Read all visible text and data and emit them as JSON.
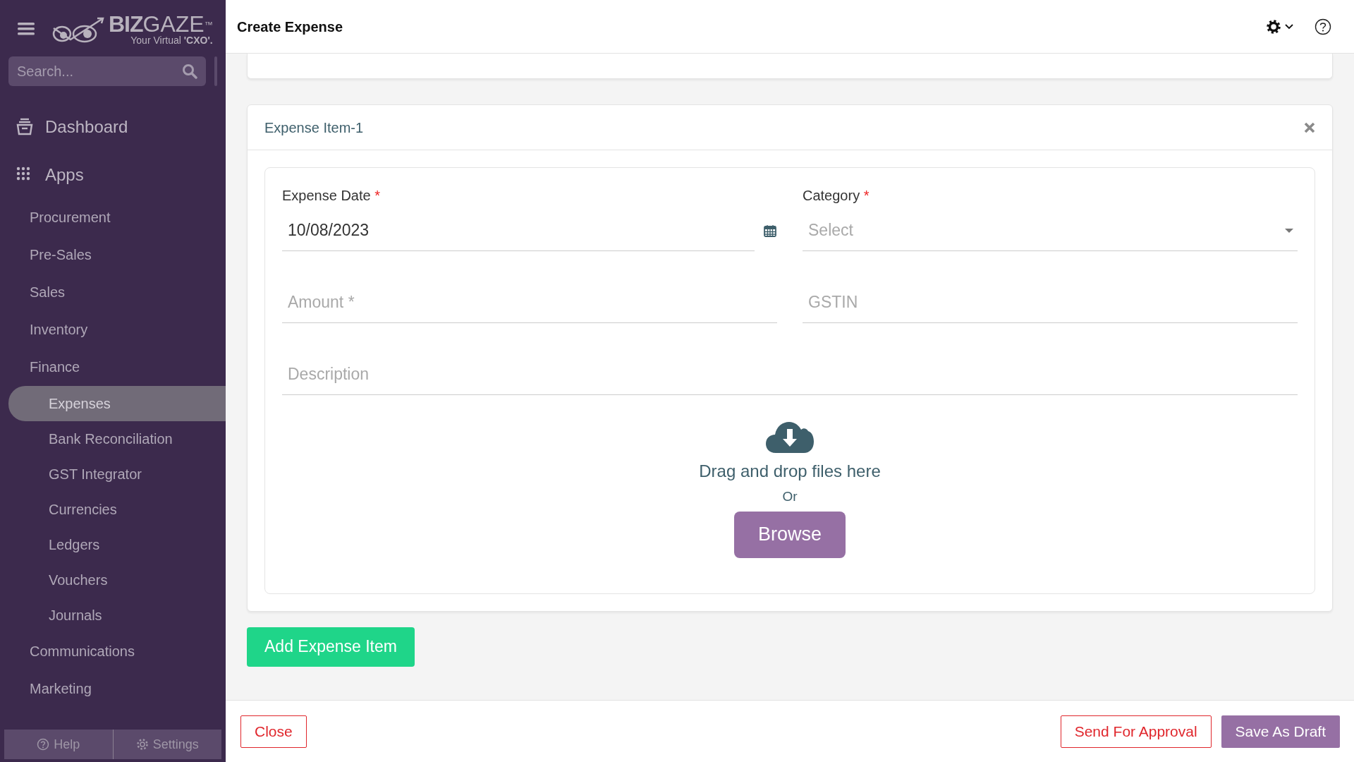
{
  "sidebar": {
    "logo": {
      "brand_bold": "BIZ",
      "brand_light": "GAZE",
      "trademark": "™",
      "tagline": "Your Virtual ",
      "tagline_bold": "'CXO'."
    },
    "search": {
      "placeholder": "Search..."
    },
    "items": [
      {
        "label": "Dashboard",
        "kind": "dashboard",
        "selected": false
      },
      {
        "label": "Apps",
        "kind": "apps",
        "selected": false,
        "children": [
          {
            "label": "Procurement",
            "selected": false
          },
          {
            "label": "Pre-Sales",
            "selected": false
          },
          {
            "label": "Sales",
            "selected": false
          },
          {
            "label": "Inventory",
            "selected": false
          },
          {
            "label": "Finance",
            "selected": false,
            "children": [
              {
                "label": "Expenses",
                "selected": true
              },
              {
                "label": "Bank Reconciliation",
                "selected": false
              },
              {
                "label": "GST Integrator",
                "selected": false
              },
              {
                "label": "Currencies",
                "selected": false
              },
              {
                "label": "Ledgers",
                "selected": false
              },
              {
                "label": "Vouchers",
                "selected": false
              },
              {
                "label": "Journals",
                "selected": false
              }
            ]
          },
          {
            "label": "Communications",
            "selected": false
          },
          {
            "label": "Marketing",
            "selected": false
          }
        ]
      }
    ],
    "footer": [
      {
        "label": "Help",
        "kind": "help"
      },
      {
        "label": "Settings",
        "kind": "settings"
      }
    ]
  },
  "header": {
    "title": "Create Expense"
  },
  "expense_item": {
    "title": "Expense Item-1",
    "fields": [
      {
        "kind": "date",
        "label": "Expense Date",
        "required_mark": "*",
        "value": "10/08/2023"
      },
      {
        "kind": "select",
        "label": "Category",
        "required_mark": "*",
        "placeholder": "Select"
      },
      {
        "kind": "text",
        "placeholder": "Amount *"
      },
      {
        "kind": "text",
        "placeholder": "GSTIN"
      },
      {
        "kind": "wide",
        "placeholder": "Description"
      }
    ],
    "upload": {
      "hint": "Drag and drop files here",
      "or": "Or",
      "button": "Browse"
    }
  },
  "add_button": "Add Expense Item",
  "footer": {
    "close": "Close",
    "send": "Send For Approval",
    "save": "Save As Draft"
  }
}
